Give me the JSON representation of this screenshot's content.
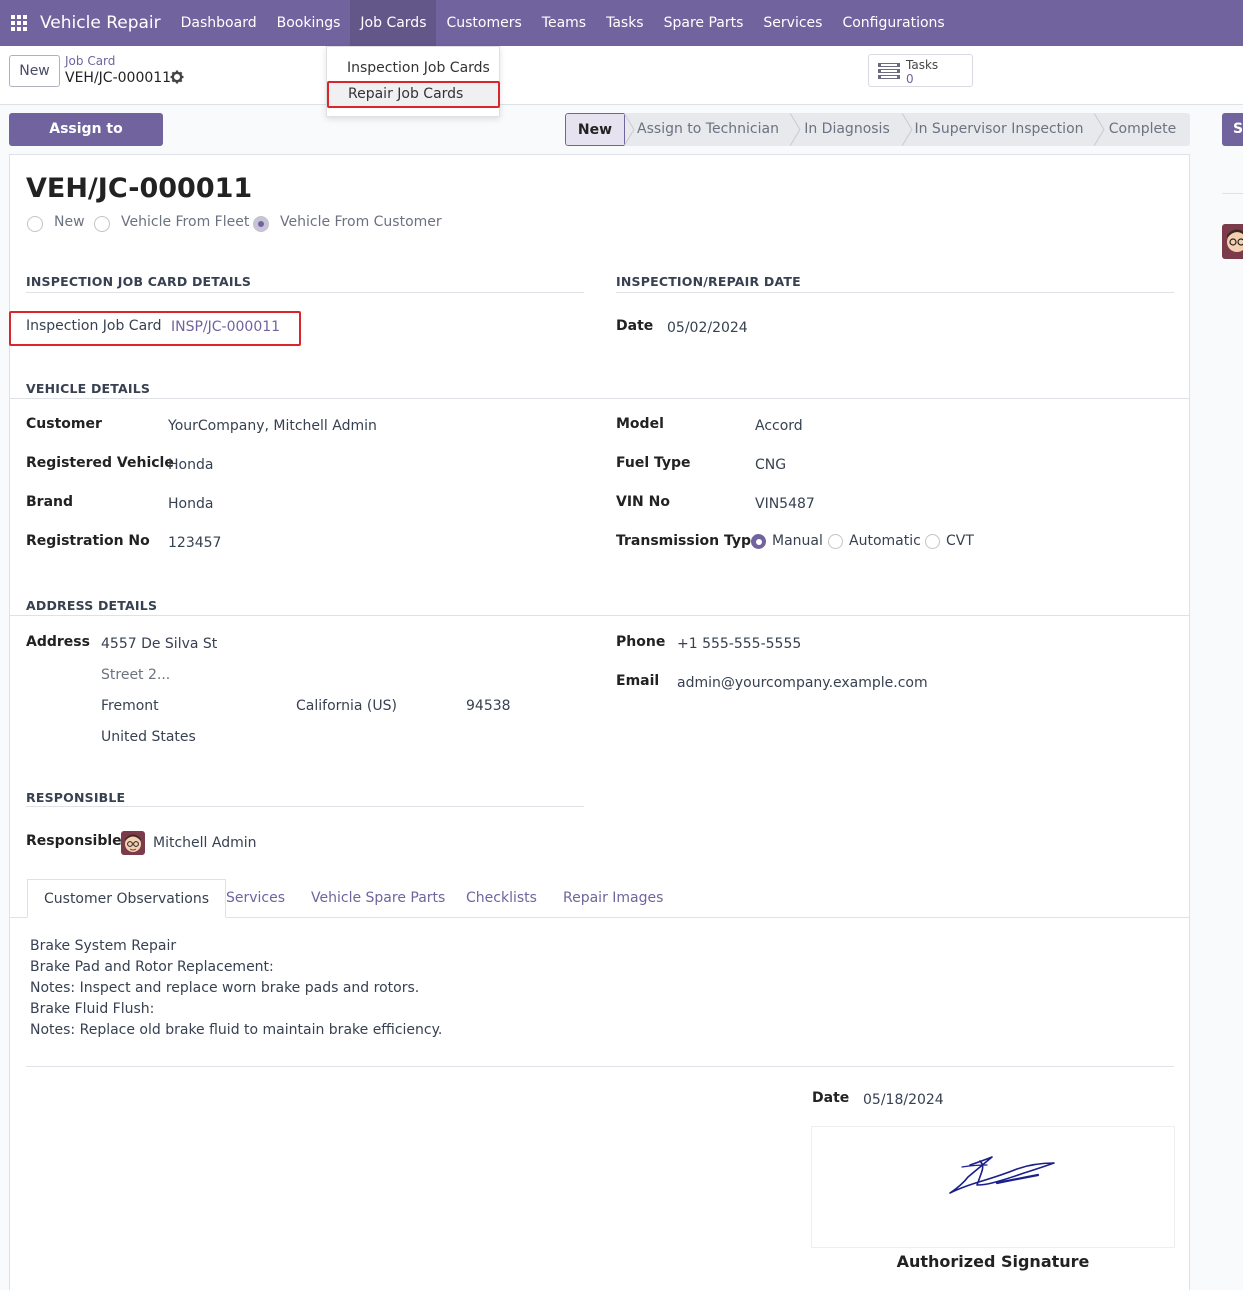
{
  "navbar": {
    "app_name": "Vehicle Repair",
    "menu": [
      "Dashboard",
      "Bookings",
      "Job Cards",
      "Customers",
      "Teams",
      "Tasks",
      "Spare Parts",
      "Services",
      "Configurations"
    ],
    "active": "Job Cards"
  },
  "dropdown": {
    "items": [
      "Inspection Job Cards",
      "Repair Job Cards"
    ],
    "highlighted": "Repair Job Cards"
  },
  "control": {
    "new_label": "New",
    "breadcrumb_parent": "Job Card",
    "breadcrumb_current": "VEH/JC-000011",
    "tasks_label": "Tasks",
    "tasks_count": "0"
  },
  "actions": {
    "assign_label": "Assign to Technician",
    "right_btn_label": "Se"
  },
  "statusbar": {
    "stages": [
      "New",
      "Assign to Technician",
      "In Diagnosis",
      "In Supervisor Inspection",
      "Complete"
    ],
    "current": "New"
  },
  "record": {
    "title": "VEH/JC-000011",
    "source_options": [
      "New",
      "Vehicle From Fleet",
      "Vehicle From Customer"
    ],
    "source_selected": "Vehicle From Customer"
  },
  "inspection": {
    "section": "INSPECTION JOB CARD DETAILS",
    "job_card_label": "Inspection Job Card",
    "job_card_value": "INSP/JC-000011"
  },
  "repair_date": {
    "section": "INSPECTION/REPAIR DATE",
    "date_label": "Date",
    "date_value": "05/02/2024"
  },
  "vehicle": {
    "section": "VEHICLE DETAILS",
    "customer_label": "Customer",
    "customer_value": "YourCompany, Mitchell Admin",
    "registered_label": "Registered Vehicle",
    "registered_value": "Honda",
    "brand_label": "Brand",
    "brand_value": "Honda",
    "regno_label": "Registration No",
    "regno_value": "123457",
    "model_label": "Model",
    "model_value": "Accord",
    "fuel_label": "Fuel Type",
    "fuel_value": "CNG",
    "vin_label": "VIN No",
    "vin_value": "VIN5487",
    "transmission_label": "Transmission Type",
    "transmission_options": [
      "Manual",
      "Automatic",
      "CVT"
    ],
    "transmission_selected": "Manual"
  },
  "address": {
    "section": "ADDRESS DETAILS",
    "address_label": "Address",
    "street": "4557 De Silva St",
    "street2_placeholder": "Street 2...",
    "city": "Fremont",
    "state": "California (US)",
    "zip": "94538",
    "country": "United States",
    "phone_label": "Phone",
    "phone_value": "+1 555-555-5555",
    "email_label": "Email",
    "email_value": "admin@yourcompany.example.com"
  },
  "responsible": {
    "section": "RESPONSIBLE",
    "label": "Responsible",
    "value": "Mitchell Admin"
  },
  "tabs": {
    "items": [
      "Customer Observations",
      "Services",
      "Vehicle Spare Parts",
      "Checklists",
      "Repair Images"
    ],
    "active": "Customer Observations"
  },
  "observations": {
    "lines": [
      "Brake System Repair",
      "Brake Pad and Rotor Replacement:",
      "Notes: Inspect and replace worn brake pads and rotors.",
      "Brake Fluid Flush:",
      "Notes: Replace old brake fluid to maintain brake efficiency."
    ]
  },
  "signature": {
    "date_label": "Date",
    "date_value": "05/18/2024",
    "caption": "Authorized Signature"
  },
  "colors": {
    "brand": "#71639e",
    "highlight": "#d9262b"
  }
}
